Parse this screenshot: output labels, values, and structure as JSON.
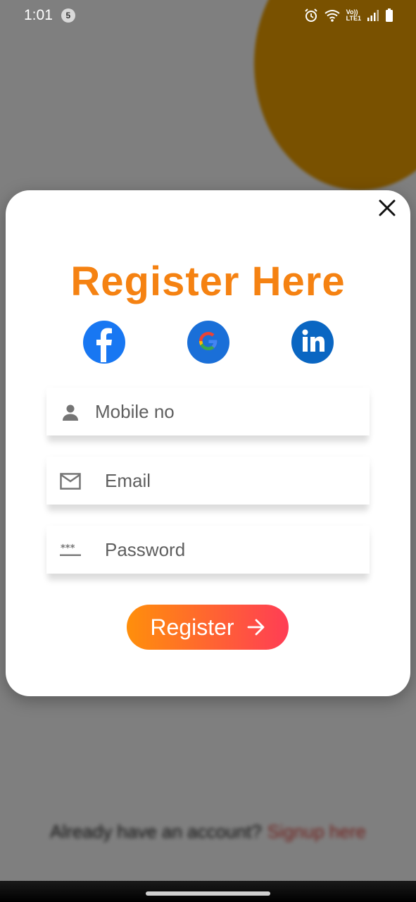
{
  "status_bar": {
    "time": "1:01",
    "notification_count": "5",
    "network_label_top": "Vo))",
    "network_label_bottom": "LTE1"
  },
  "background": {
    "footer_prompt": "Already have an account?",
    "footer_link": "Signup here"
  },
  "modal": {
    "title": "Register Here",
    "social": [
      {
        "name": "facebook-icon",
        "color": "#1877f2"
      },
      {
        "name": "google-icon",
        "color": "#1a6fd8"
      },
      {
        "name": "linkedin-icon",
        "color": "#0a66c2"
      }
    ],
    "fields": {
      "mobile": {
        "placeholder": "Mobile no",
        "value": ""
      },
      "email": {
        "placeholder": "Email",
        "value": ""
      },
      "password": {
        "placeholder": "Password",
        "value": ""
      }
    },
    "register_label": "Register"
  },
  "colors": {
    "accent": "#f58212",
    "button_gradient_start": "#ff8f0b",
    "button_gradient_end": "#ff3d55",
    "scrim": "rgba(0,0,0,0.5)"
  }
}
